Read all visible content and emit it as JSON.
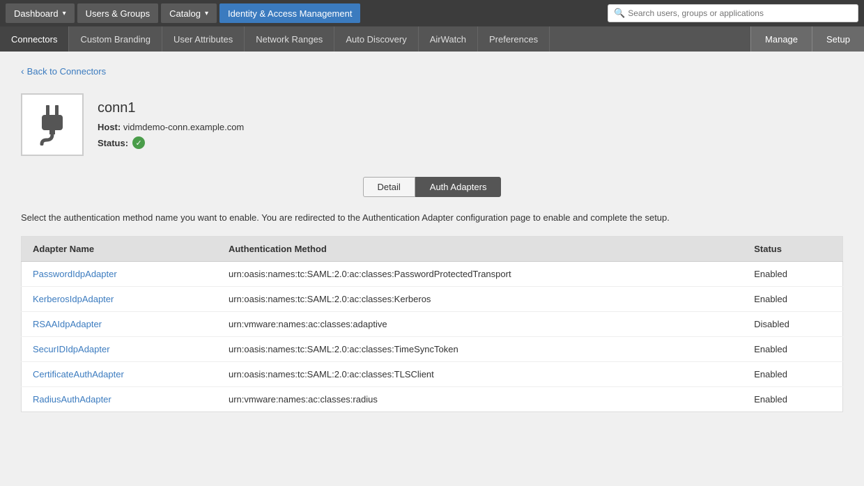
{
  "topNav": {
    "buttons": [
      {
        "id": "dashboard",
        "label": "Dashboard",
        "hasDropdown": true,
        "active": false
      },
      {
        "id": "users-groups",
        "label": "Users & Groups",
        "hasDropdown": false,
        "active": false
      },
      {
        "id": "catalog",
        "label": "Catalog",
        "hasDropdown": true,
        "active": false
      },
      {
        "id": "iam",
        "label": "Identity & Access Management",
        "hasDropdown": false,
        "active": true
      }
    ],
    "search": {
      "placeholder": "Search users, groups or applications"
    }
  },
  "secondNav": {
    "items": [
      {
        "id": "connectors",
        "label": "Connectors",
        "active": true
      },
      {
        "id": "custom-branding",
        "label": "Custom Branding",
        "active": false
      },
      {
        "id": "user-attributes",
        "label": "User Attributes",
        "active": false
      },
      {
        "id": "network-ranges",
        "label": "Network Ranges",
        "active": false
      },
      {
        "id": "auto-discovery",
        "label": "Auto Discovery",
        "active": false
      },
      {
        "id": "airwatch",
        "label": "AirWatch",
        "active": false
      },
      {
        "id": "preferences",
        "label": "Preferences",
        "active": false
      }
    ],
    "rightButtons": [
      {
        "id": "manage",
        "label": "Manage"
      },
      {
        "id": "setup",
        "label": "Setup"
      }
    ]
  },
  "backLink": {
    "label": "Back to Connectors"
  },
  "connector": {
    "name": "conn1",
    "host_label": "Host:",
    "host_value": "vidmdemo-conn.example.com",
    "status_label": "Status:",
    "status_ok": true
  },
  "tabs": [
    {
      "id": "detail",
      "label": "Detail",
      "active": false
    },
    {
      "id": "auth-adapters",
      "label": "Auth Adapters",
      "active": true
    }
  ],
  "descriptionText": "Select the authentication method name you want to enable. You are redirected to the Authentication Adapter configuration page to enable and complete the setup.",
  "table": {
    "headers": [
      {
        "id": "adapter-name",
        "label": "Adapter Name"
      },
      {
        "id": "auth-method",
        "label": "Authentication Method"
      },
      {
        "id": "status",
        "label": "Status"
      }
    ],
    "rows": [
      {
        "adapterName": "PasswordIdpAdapter",
        "authMethod": "urn:oasis:names:tc:SAML:2.0:ac:classes:PasswordProtectedTransport",
        "status": "Enabled"
      },
      {
        "adapterName": "KerberosIdpAdapter",
        "authMethod": "urn:oasis:names:tc:SAML:2.0:ac:classes:Kerberos",
        "status": "Enabled"
      },
      {
        "adapterName": "RSAAIdpAdapter",
        "authMethod": "urn:vmware:names:ac:classes:adaptive",
        "status": "Disabled"
      },
      {
        "adapterName": "SecurIDIdpAdapter",
        "authMethod": "urn:oasis:names:tc:SAML:2.0:ac:classes:TimeSyncToken",
        "status": "Enabled"
      },
      {
        "adapterName": "CertificateAuthAdapter",
        "authMethod": "urn:oasis:names:tc:SAML:2.0:ac:classes:TLSClient",
        "status": "Enabled"
      },
      {
        "adapterName": "RadiusAuthAdapter",
        "authMethod": "urn:vmware:names:ac:classes:radius",
        "status": "Enabled"
      }
    ]
  }
}
